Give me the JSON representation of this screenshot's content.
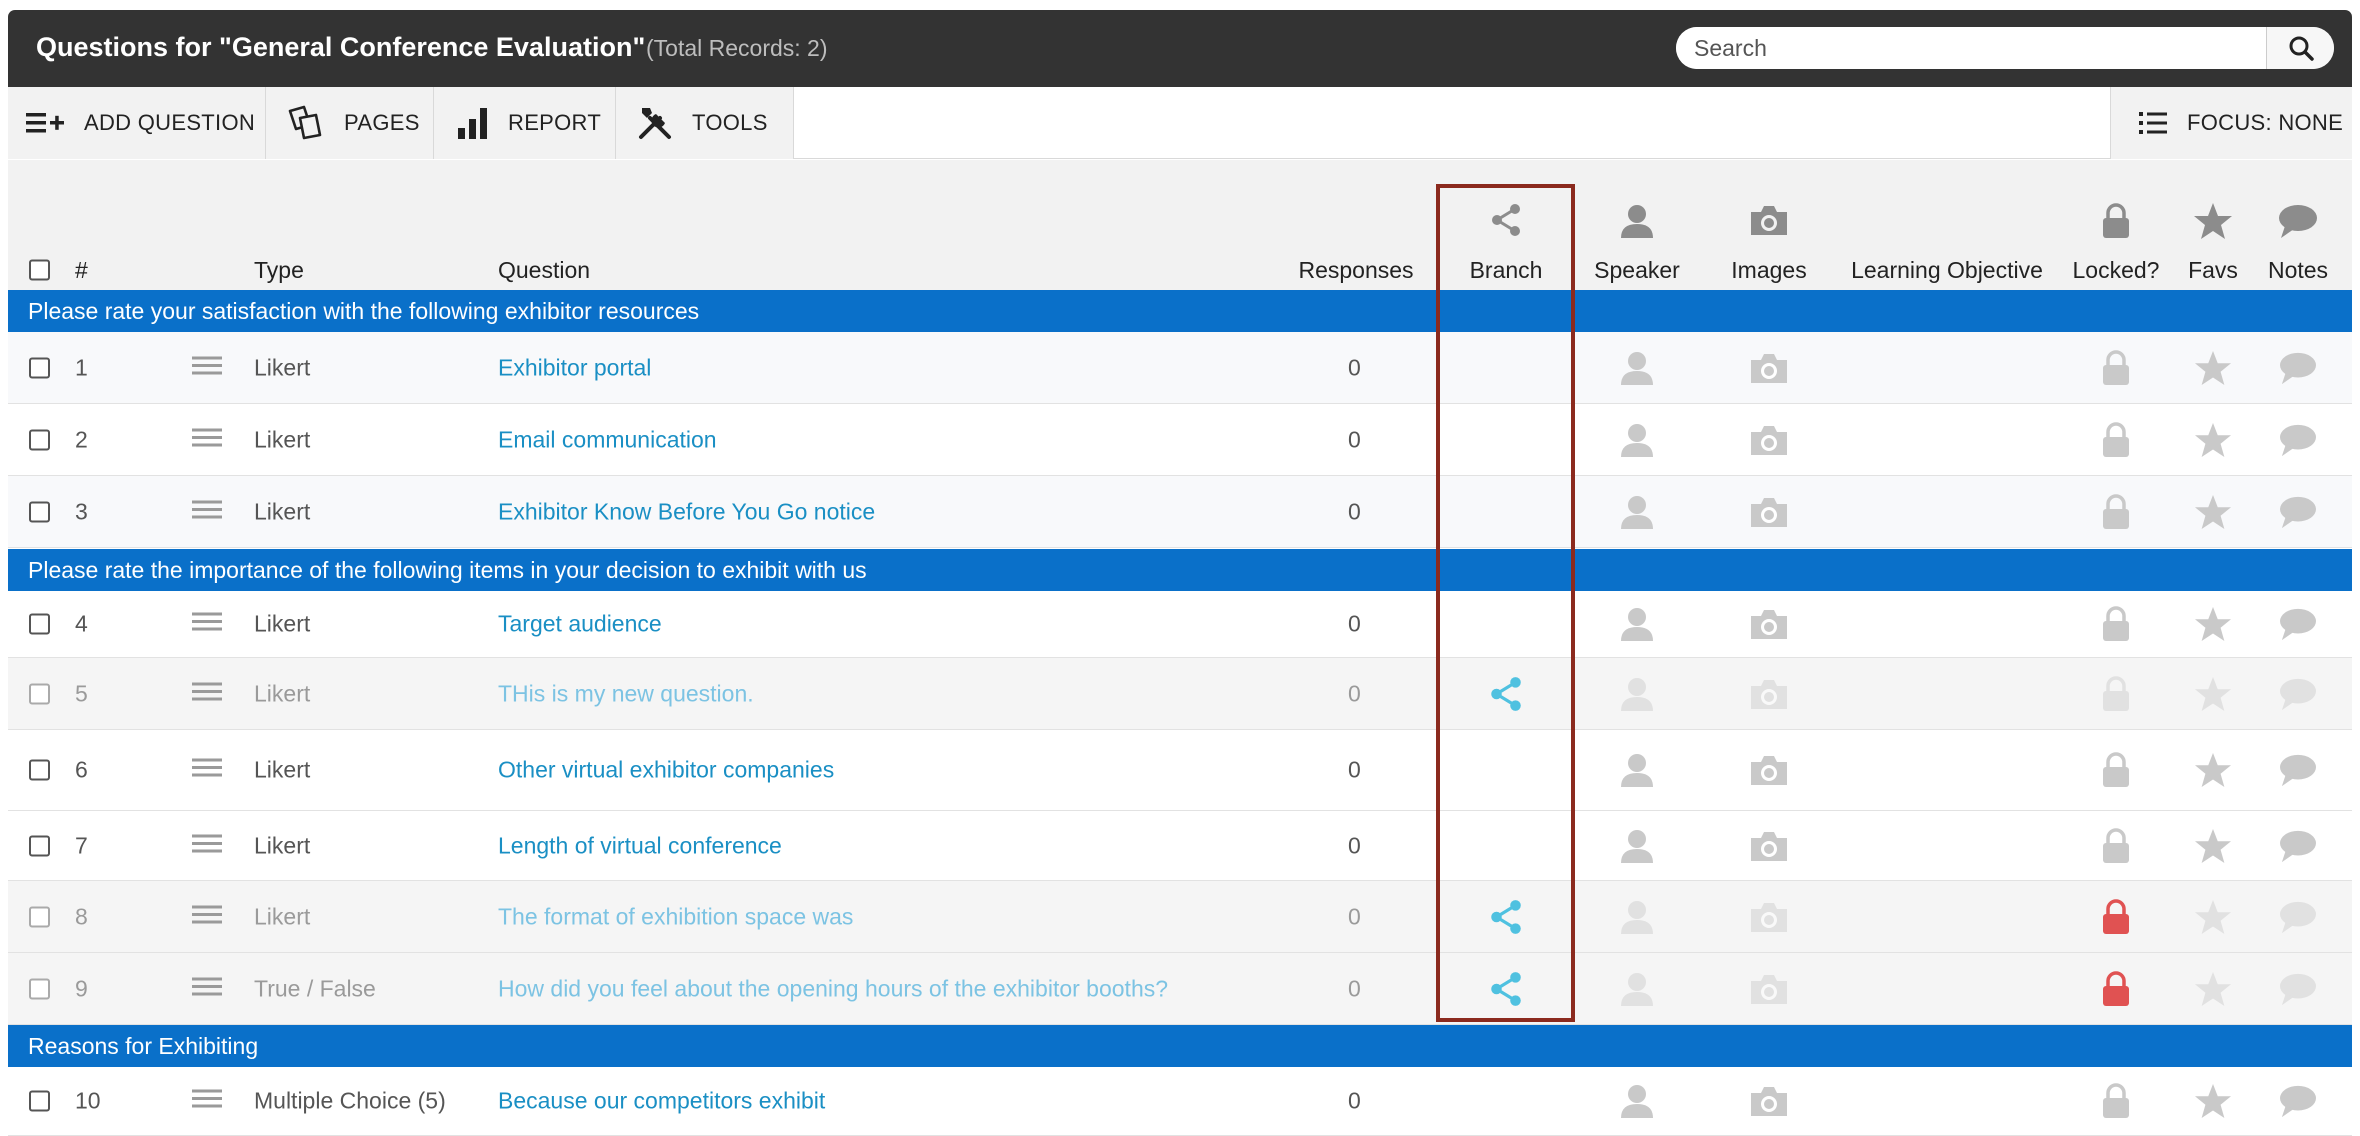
{
  "header": {
    "title": "Questions for \"General Conference Evaluation\"",
    "total": "(Total Records: 2)",
    "search_placeholder": "Search"
  },
  "toolbar": {
    "add_question": "ADD QUESTION",
    "pages": "PAGES",
    "report": "REPORT",
    "tools": "TOOLS",
    "focus": "FOCUS: NONE"
  },
  "columns": {
    "num": "#",
    "type": "Type",
    "question": "Question",
    "responses": "Responses",
    "branch": "Branch",
    "speaker": "Speaker",
    "images": "Images",
    "learning_objective": "Learning Objective",
    "locked": "Locked?",
    "favs": "Favs",
    "notes": "Notes"
  },
  "sections": [
    "Please rate your satisfaction with the following exhibitor resources",
    "Please rate the importance of the following items in your decision to exhibit with us",
    "Reasons for Exhibiting"
  ],
  "rows": [
    {
      "num": "1",
      "type": "Likert",
      "question": "Exhibitor portal",
      "responses": "0",
      "branch": false,
      "locked": false,
      "dim": false
    },
    {
      "num": "2",
      "type": "Likert",
      "question": "Email communication",
      "responses": "0",
      "branch": false,
      "locked": false,
      "dim": false
    },
    {
      "num": "3",
      "type": "Likert",
      "question": "Exhibitor Know Before You Go notice",
      "responses": "0",
      "branch": false,
      "locked": false,
      "dim": false
    },
    {
      "num": "4",
      "type": "Likert",
      "question": "Target audience",
      "responses": "0",
      "branch": false,
      "locked": false,
      "dim": false
    },
    {
      "num": "5",
      "type": "Likert",
      "question": "THis is my new question.",
      "responses": "0",
      "branch": true,
      "locked": false,
      "dim": true
    },
    {
      "num": "6",
      "type": "Likert",
      "question": "Other virtual exhibitor companies",
      "responses": "0",
      "branch": false,
      "locked": false,
      "dim": false
    },
    {
      "num": "7",
      "type": "Likert",
      "question": "Length of virtual conference",
      "responses": "0",
      "branch": false,
      "locked": false,
      "dim": false
    },
    {
      "num": "8",
      "type": "Likert",
      "question": "The format of exhibition space was",
      "responses": "0",
      "branch": true,
      "locked": true,
      "dim": true
    },
    {
      "num": "9",
      "type": "True / False",
      "question": "How did you feel about the opening hours of the exhibitor booths?",
      "responses": "0",
      "branch": true,
      "locked": true,
      "dim": true
    },
    {
      "num": "10",
      "type": "Multiple Choice (5)",
      "question": "Because our competitors exhibit",
      "responses": "0",
      "branch": false,
      "locked": false,
      "dim": false
    }
  ],
  "colors": {
    "section_bg": "#0a70c9",
    "link": "#1a8fc4",
    "branch_active": "#4fc1e0",
    "lock_active": "#e05252",
    "highlight_box": "#8b2a1e"
  }
}
